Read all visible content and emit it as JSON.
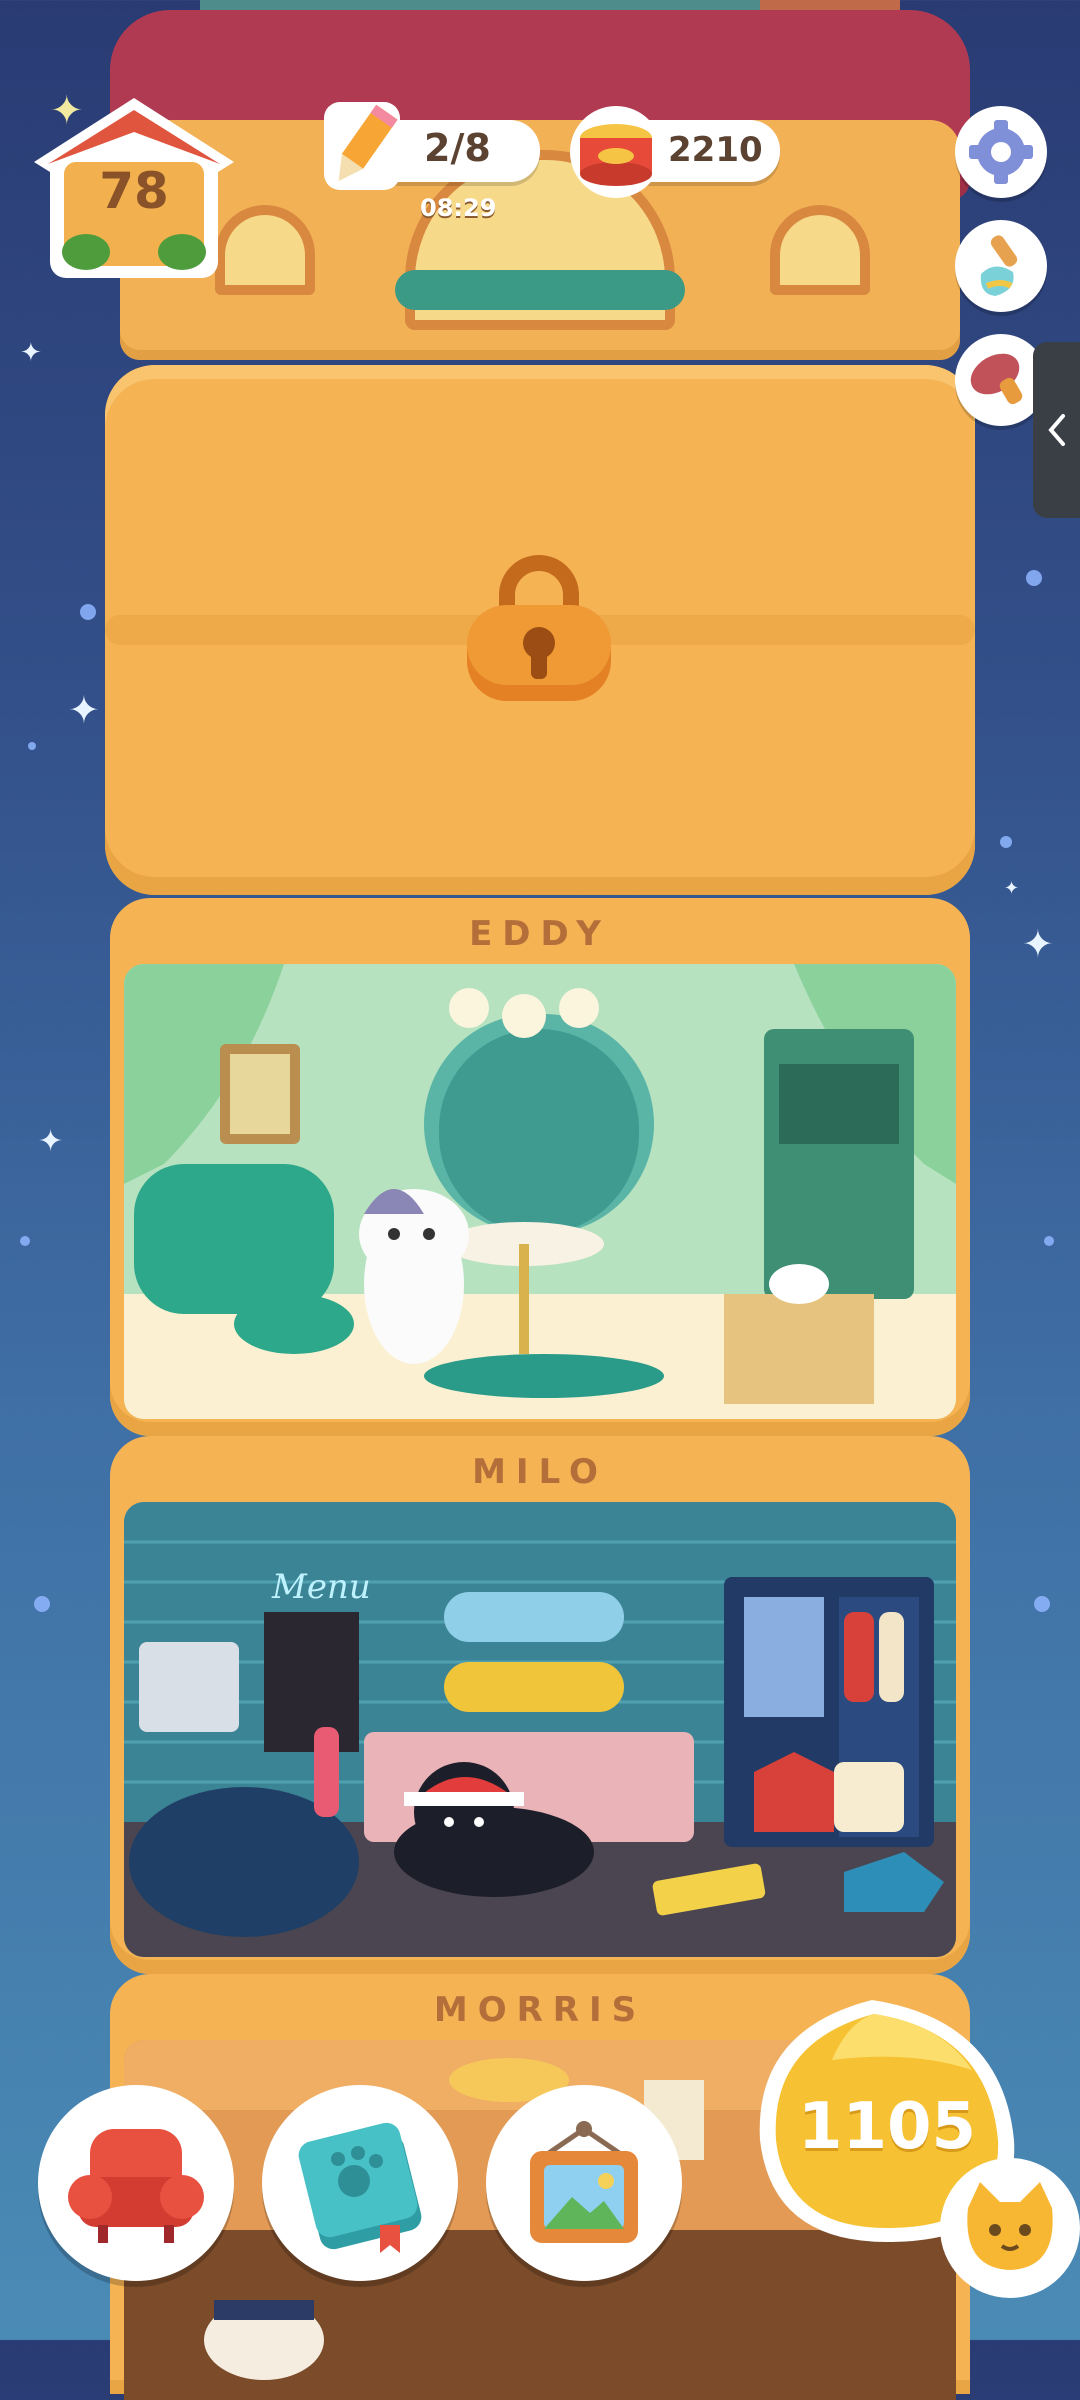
{
  "hud": {
    "house_level": "78",
    "pencil_progress": "2/8",
    "pencil_timer": "08:29",
    "cans": "2210",
    "gems": "1105"
  },
  "rooms": {
    "locked": {
      "state": "locked"
    },
    "eddy": {
      "name": "EDDY"
    },
    "milo": {
      "name": "MILO",
      "menu_sign": "Menu"
    },
    "morris": {
      "name": "MORRIS"
    }
  },
  "icons": {
    "side": [
      "settings-gear-icon",
      "paint-brush-icon",
      "stamp-icon"
    ],
    "bottom": [
      "furniture-armchair-icon",
      "paw-journal-icon",
      "picture-frame-icon",
      "cat-face-icon"
    ],
    "drawer": "chevron-left-icon"
  },
  "colors": {
    "tower": "#f5b354",
    "roof": "#b03a52",
    "accent_yellow": "#f6c233",
    "cat_orange": "#f7b733",
    "sofa_red": "#e8503f",
    "journal_teal": "#35b0b6"
  }
}
